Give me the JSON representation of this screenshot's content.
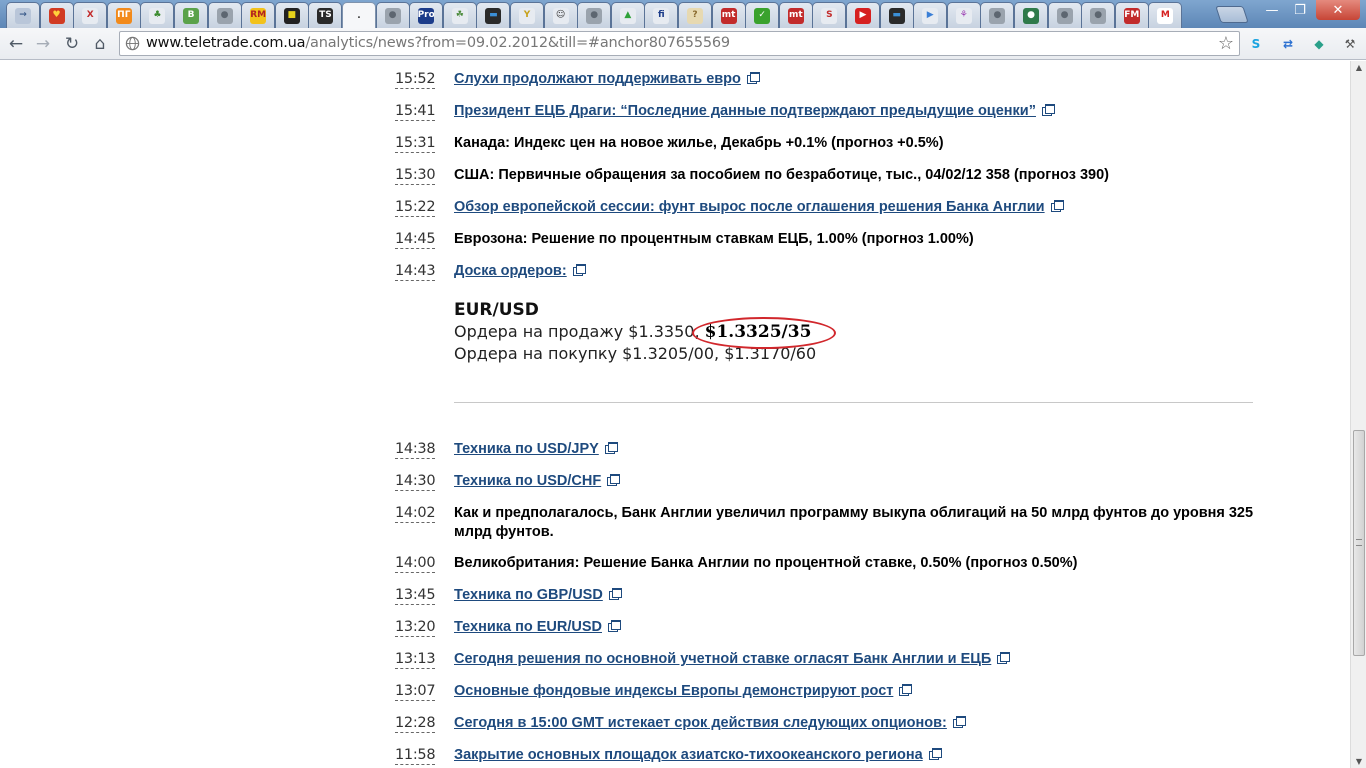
{
  "browser": {
    "tab_favicons": [
      {
        "name": "tab-1",
        "glyph": "→",
        "color": "#b9c6d9",
        "fg": "#3a5b8a"
      },
      {
        "name": "tab-2",
        "glyph": "♥",
        "color": "#d13b23",
        "fg": "#ffd23b"
      },
      {
        "name": "tab-3",
        "glyph": "X",
        "color": "#e7ebf1",
        "fg": "#c22b2b"
      },
      {
        "name": "tab-4",
        "glyph": "ПГ",
        "color": "#f28a1b",
        "fg": "#ffffff"
      },
      {
        "name": "tab-5",
        "glyph": "♣",
        "color": "#e7ebf1",
        "fg": "#3a8a2d"
      },
      {
        "name": "tab-6",
        "glyph": "B",
        "color": "#5aa24a",
        "fg": "#ffffff"
      },
      {
        "name": "tab-7",
        "glyph": "●",
        "color": "#9aa3ad",
        "fg": "#5d6670"
      },
      {
        "name": "tab-8",
        "glyph": "RM",
        "color": "#f2c21b",
        "fg": "#b22020"
      },
      {
        "name": "tab-9",
        "glyph": "■",
        "color": "#222222",
        "fg": "#e6d21b"
      },
      {
        "name": "tab-10",
        "glyph": "TS",
        "color": "#2a2a2a",
        "fg": "#ffffff"
      },
      {
        "name": "tab-11",
        "glyph": ".",
        "color": "#f6f7f9",
        "fg": "#333333"
      },
      {
        "name": "tab-12",
        "glyph": "●",
        "color": "#9aa3ad",
        "fg": "#5d6670"
      },
      {
        "name": "tab-13",
        "glyph": "Pro",
        "color": "#1c3c8a",
        "fg": "#ffffff"
      },
      {
        "name": "tab-14",
        "glyph": "☘",
        "color": "#e7ebf1",
        "fg": "#4a8a3a"
      },
      {
        "name": "tab-15",
        "glyph": "▬",
        "color": "#2a2a2a",
        "fg": "#3b8fd6"
      },
      {
        "name": "tab-16",
        "glyph": "Y",
        "color": "#e7ebf1",
        "fg": "#c7a21b"
      },
      {
        "name": "tab-17",
        "glyph": "☺",
        "color": "#e7ebf1",
        "fg": "#333333"
      },
      {
        "name": "tab-18",
        "glyph": "●",
        "color": "#9aa3ad",
        "fg": "#5d6670"
      },
      {
        "name": "tab-19",
        "glyph": "▲",
        "color": "#e7ebf1",
        "fg": "#2fa23a"
      },
      {
        "name": "tab-20",
        "glyph": "fi",
        "color": "#e7ebf1",
        "fg": "#1c3c8a"
      },
      {
        "name": "tab-21",
        "glyph": "?",
        "color": "#e7d9b1",
        "fg": "#8a6a2d"
      },
      {
        "name": "tab-22",
        "glyph": "mt",
        "color": "#c22b2b",
        "fg": "#ffffff"
      },
      {
        "name": "tab-23",
        "glyph": "✓",
        "color": "#3aa22d",
        "fg": "#ffffff"
      },
      {
        "name": "tab-24",
        "glyph": "mt",
        "color": "#c22b2b",
        "fg": "#ffffff"
      },
      {
        "name": "tab-25",
        "glyph": "S",
        "color": "#e7ebf1",
        "fg": "#c22b2b"
      },
      {
        "name": "tab-26",
        "glyph": "▶",
        "color": "#d62020",
        "fg": "#ffffff"
      },
      {
        "name": "tab-27",
        "glyph": "▬",
        "color": "#2a2a2a",
        "fg": "#3b8fd6"
      },
      {
        "name": "tab-28",
        "glyph": "▶",
        "color": "#e7ebf1",
        "fg": "#3b7fd6"
      },
      {
        "name": "tab-29",
        "glyph": "⚘",
        "color": "#e7ebf1",
        "fg": "#9a3ab1"
      },
      {
        "name": "tab-30",
        "glyph": "●",
        "color": "#9aa3ad",
        "fg": "#5d6670"
      },
      {
        "name": "tab-31",
        "glyph": "●",
        "color": "#2f7a4a",
        "fg": "#ffffff"
      },
      {
        "name": "tab-32",
        "glyph": "●",
        "color": "#9aa3ad",
        "fg": "#5d6670"
      },
      {
        "name": "tab-33",
        "glyph": "●",
        "color": "#9aa3ad",
        "fg": "#5d6670"
      },
      {
        "name": "tab-34",
        "glyph": "FM",
        "color": "#c22b2b",
        "fg": "#ffffff"
      },
      {
        "name": "tab-35",
        "glyph": "M",
        "color": "#ffffff",
        "fg": "#d62020"
      }
    ],
    "window_controls": {
      "minimize": "—",
      "maximize": "❐",
      "close": "✕"
    },
    "nav": {
      "back": "←",
      "forward": "→",
      "reload": "↻",
      "home": "⌂"
    },
    "url_host": "www.teletrade.com.ua",
    "url_path": "/analytics/news?from=09.02.2012&till=#anchor807655569",
    "star": "☆",
    "extensions": [
      {
        "name": "skype-icon",
        "glyph": "S",
        "color": "#1aa3e0"
      },
      {
        "name": "sync-icon",
        "glyph": "⇄",
        "color": "#2a6fd0"
      },
      {
        "name": "shield-icon",
        "glyph": "◆",
        "color": "#2aa08a"
      },
      {
        "name": "wrench-icon",
        "glyph": "⚒",
        "color": "#555555"
      }
    ]
  },
  "news": [
    {
      "time": "15:52",
      "text": "Слухи продолжают поддерживать евро",
      "link": true
    },
    {
      "time": "15:41",
      "text": "Президент ЕЦБ Драги: “Последние данные подтверждают предыдущие оценки”",
      "link": true
    },
    {
      "time": "15:31",
      "text": "Канада: Индекс цен на новое жилье, Декабрь +0.1% (прогноз +0.5%)",
      "link": false
    },
    {
      "time": "15:30",
      "text": "США: Первичные обращения за пособием по безработице, тыс., 04/02/12 358 (прогноз 390)",
      "link": false
    },
    {
      "time": "15:22",
      "text": "Обзор европейской сессии: фунт вырос после оглашения решения Банка Англии",
      "link": true
    },
    {
      "time": "14:45",
      "text": "Еврозона: Решение по процентным ставкам ЕЦБ, 1.00% (прогноз 1.00%)",
      "link": false
    },
    {
      "time": "14:43",
      "text": "Доска ордеров:",
      "link": true
    }
  ],
  "orders": {
    "pair": "EUR/USD",
    "sell_prefix": "Ордера на продажу $1.3350,",
    "sell_highlight": "$1.3325/35",
    "buy": "Ордера на покупку $1.3205/00, $1.3170/60"
  },
  "news2": [
    {
      "time": "14:38",
      "text": "Техника по USD/JPY",
      "link": true
    },
    {
      "time": "14:30",
      "text": "Техника по USD/CHF",
      "link": true
    },
    {
      "time": "14:02",
      "text": "Как и предполагалось, Банк Англии увеличил программу выкупа облигаций на 50 млрд фунтов до уровня 325 млрд фунтов.",
      "link": false
    },
    {
      "time": "14:00",
      "text": "Великобритания: Решение Банка Англии по процентной ставке, 0.50% (прогноз 0.50%)",
      "link": false
    },
    {
      "time": "13:45",
      "text": "Техника по GBP/USD",
      "link": true
    },
    {
      "time": "13:20",
      "text": "Техника по EUR/USD",
      "link": true
    },
    {
      "time": "13:13",
      "text": "Сегодня решения по основной учетной ставке огласят Банк Англии и ЕЦБ",
      "link": true
    },
    {
      "time": "13:07",
      "text": "Основные фондовые индексы Европы демонстрируют рост",
      "link": true
    },
    {
      "time": "12:28",
      "text": "Сегодня в 15:00 GMT истекает срок действия следующих опционов:",
      "link": true
    },
    {
      "time": "11:58",
      "text": "Закрытие основных площадок азиатско-тихоокеанского региона",
      "link": true
    }
  ],
  "colors": {
    "link": "#1e4a7e",
    "highlight_ring": "#d1272c"
  }
}
